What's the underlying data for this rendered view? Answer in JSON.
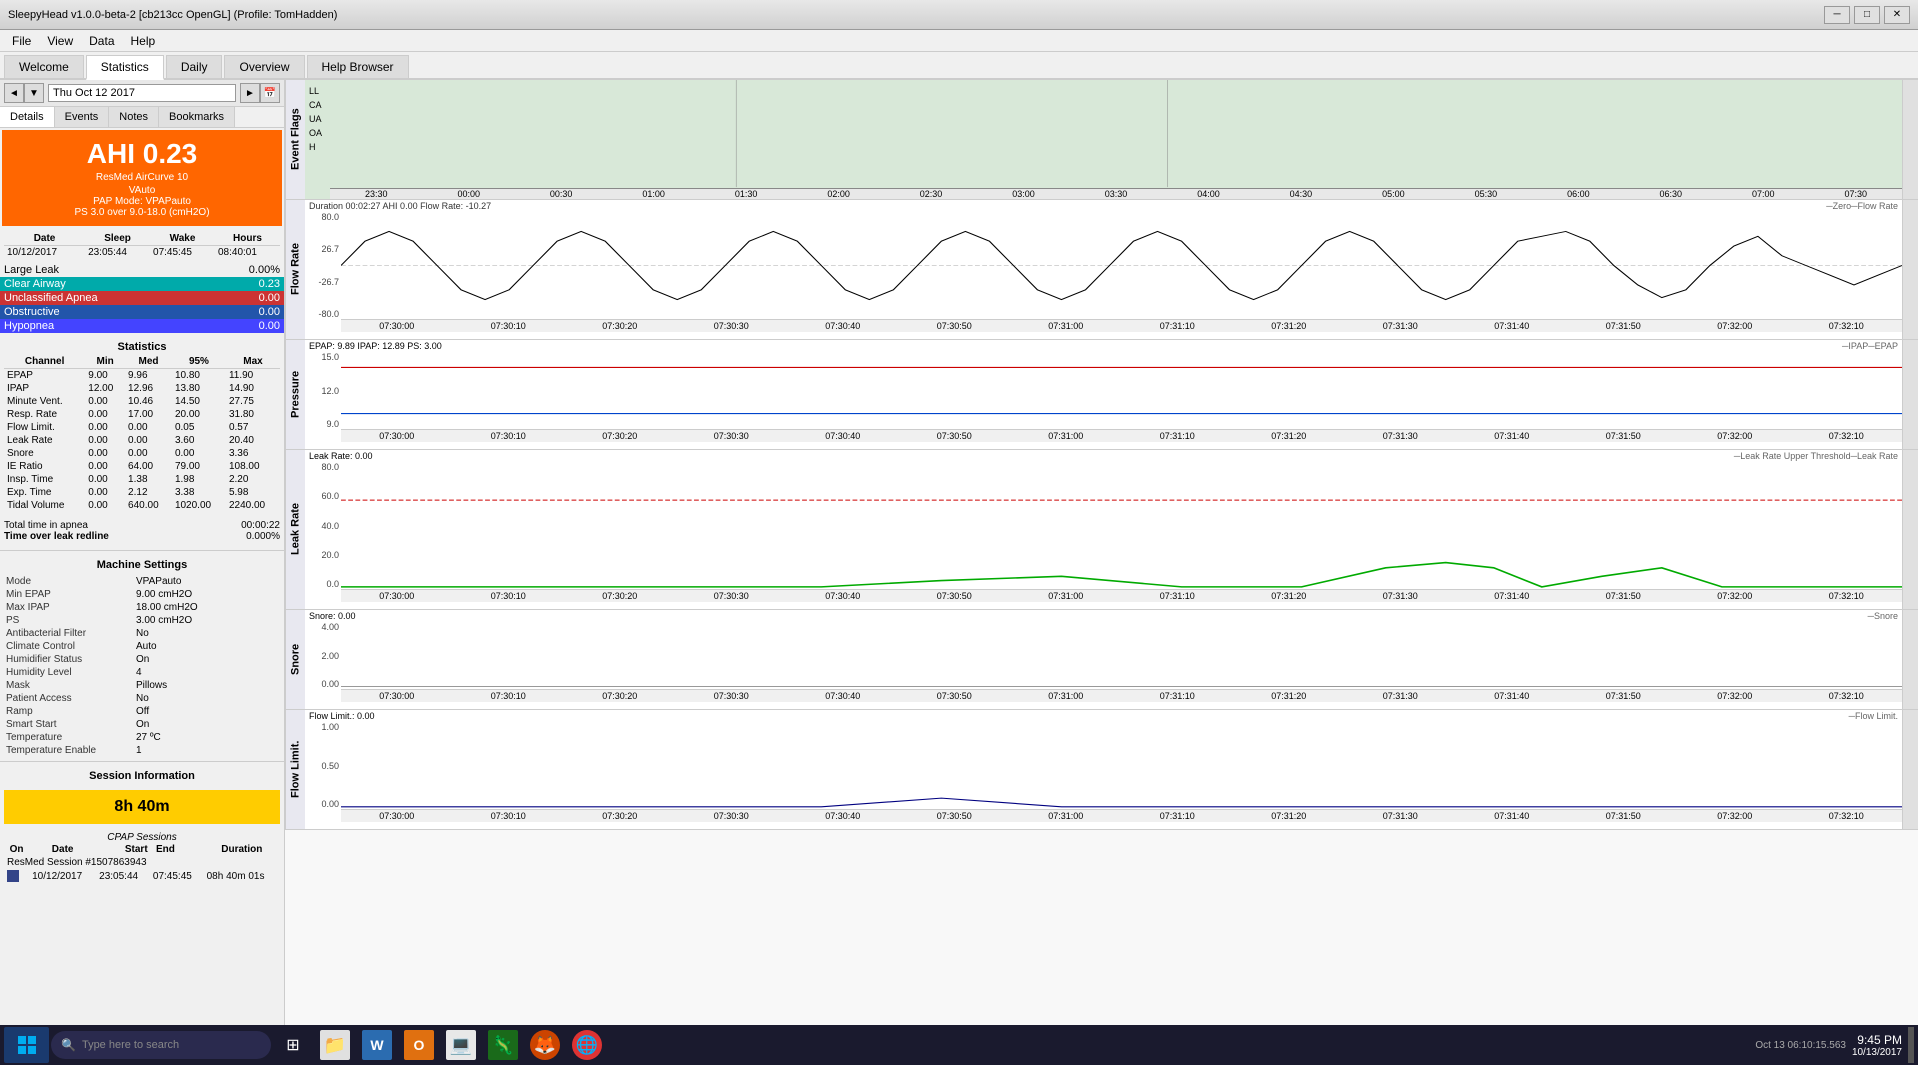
{
  "titlebar": {
    "title": "SleepyHead v1.0.0-beta-2 [cb213cc OpenGL] (Profile: TomHadden)",
    "minimize": "─",
    "maximize": "□",
    "close": "✕"
  },
  "menu": {
    "items": [
      "File",
      "View",
      "Data",
      "Help"
    ]
  },
  "tabs": {
    "items": [
      "Welcome",
      "Statistics",
      "Daily",
      "Overview",
      "Help Browser"
    ],
    "active": "Statistics"
  },
  "date_nav": {
    "prev": "◄",
    "dropdown_arrow": "▼",
    "date": "Thu Oct 12 2017",
    "next": "►",
    "calendar": "📅"
  },
  "subtabs": {
    "items": [
      "Details",
      "Events",
      "Notes",
      "Bookmarks"
    ],
    "active": "Details"
  },
  "ahi": {
    "label": "AHI 0.23",
    "device1": "ResMed AirCurve 10",
    "device2": "VAuto",
    "mode": "PAP Mode: VPAPauto",
    "ps": "PS 3.0 over 9.0-18.0 (cmH2O)"
  },
  "session_summary": {
    "headers": [
      "Date",
      "Sleep",
      "Wake",
      "Hours"
    ],
    "row": [
      "10/12/2017",
      "23:05:44",
      "07:45:45",
      "08:40:01"
    ]
  },
  "events": {
    "large_leak": {
      "label": "Large Leak",
      "value": "0.00%"
    },
    "clear_airway": {
      "label": "Clear Airway",
      "value": "0.23"
    },
    "unclassified_apnea": {
      "label": "Unclassified Apnea",
      "value": "0.00"
    },
    "obstructive": {
      "label": "Obstructive",
      "value": "0.00"
    },
    "hypopnea": {
      "label": "Hypopnea",
      "value": "0.00"
    }
  },
  "statistics": {
    "title": "Statistics",
    "headers": [
      "Channel",
      "Min",
      "Med",
      "95%",
      "Max"
    ],
    "rows": [
      [
        "EPAP",
        "9.00",
        "9.96",
        "10.80",
        "11.90"
      ],
      [
        "IPAP",
        "12.00",
        "12.96",
        "13.80",
        "14.90"
      ],
      [
        "Minute Vent.",
        "0.00",
        "10.46",
        "14.50",
        "27.75"
      ],
      [
        "Resp. Rate",
        "0.00",
        "17.00",
        "20.00",
        "31.80"
      ],
      [
        "Flow Limit.",
        "0.00",
        "0.00",
        "0.05",
        "0.57"
      ],
      [
        "Leak Rate",
        "0.00",
        "0.00",
        "3.60",
        "20.40"
      ],
      [
        "Snore",
        "0.00",
        "0.00",
        "0.00",
        "3.36"
      ],
      [
        "IE Ratio",
        "0.00",
        "64.00",
        "79.00",
        "108.00"
      ],
      [
        "Insp. Time",
        "0.00",
        "1.38",
        "1.98",
        "2.20"
      ],
      [
        "Exp. Time",
        "0.00",
        "2.12",
        "3.38",
        "5.98"
      ],
      [
        "Tidal Volume",
        "0.00",
        "640.00",
        "1020.00",
        "2240.00"
      ]
    ]
  },
  "totals": {
    "apnea_label": "Total time in apnea",
    "apnea_value": "00:00:22",
    "leak_label": "Time over leak redline",
    "leak_value": "0.000%"
  },
  "machine_settings": {
    "title": "Machine Settings",
    "rows": [
      [
        "Mode",
        "VPAPauto"
      ],
      [
        "Min EPAP",
        "9.00 cmH2O"
      ],
      [
        "Max IPAP",
        "18.00 cmH2O"
      ],
      [
        "PS",
        "3.00 cmH2O"
      ],
      [
        "Antibacterial Filter",
        "No"
      ],
      [
        "Climate Control",
        "Auto"
      ],
      [
        "Humidifier Status",
        "On"
      ],
      [
        "Humidity Level",
        "4"
      ],
      [
        "Mask",
        "Pillows"
      ],
      [
        "Patient Access",
        "No"
      ],
      [
        "Ramp",
        "Off"
      ],
      [
        "Smart Start",
        "On"
      ],
      [
        "Temperature",
        "27 ºC"
      ],
      [
        "Temperature Enable",
        "1"
      ]
    ]
  },
  "session_info": {
    "title": "Session Information",
    "duration": "8h 40m"
  },
  "cpap_sessions": {
    "title": "CPAP Sessions",
    "headers": [
      "On",
      "Date",
      "Start",
      "End",
      "Duration"
    ],
    "rows": [
      [
        "●",
        "10/12/2017",
        "23:05:44",
        "07:45:45",
        "08h 40m 01s"
      ]
    ],
    "resmed": "ResMed Session #1507863943"
  },
  "charts": {
    "event_flags": {
      "label": "Event Flags",
      "flags": [
        "LL",
        "CA",
        "UA",
        "OA",
        "H"
      ],
      "times_overview": [
        "23:30",
        "00:00",
        "00:30",
        "01:00",
        "01:30",
        "02:00",
        "02:30",
        "03:00",
        "03:30",
        "04:00",
        "04:30",
        "05:00",
        "05:30",
        "06:00",
        "06:30",
        "07:00",
        "07:30"
      ]
    },
    "flow_rate": {
      "label": "Flow Rate",
      "title": "Duration 00:02:27 AHI 0.00 Flow Rate: -10.27",
      "legend": "─Zero─Flow Rate",
      "y_max": "80.0",
      "y_mid_pos": "26.7",
      "y_mid_neg": "-26.7",
      "y_min": "-80.0",
      "times": [
        "07:30:00",
        "07:30:10",
        "07:30:20",
        "07:30:30",
        "07:30:40",
        "07:30:50",
        "07:31:00",
        "07:31:10",
        "07:31:20",
        "07:31:30",
        "07:31:40",
        "07:31:50",
        "07:32:00",
        "07:32:10"
      ]
    },
    "pressure": {
      "label": "Pressure",
      "title": "EPAP: 9.89 IPAP: 12.89 PS: 3.00",
      "legend": "─IPAP─EPAP",
      "y_max": "15.0",
      "y_mid": "12.0",
      "y_min": "9.0",
      "times": [
        "07:30:00",
        "07:30:10",
        "07:30:20",
        "07:30:30",
        "07:30:40",
        "07:30:50",
        "07:31:00",
        "07:31:10",
        "07:31:20",
        "07:31:30",
        "07:31:40",
        "07:31:50",
        "07:32:00",
        "07:32:10"
      ]
    },
    "leak_rate": {
      "label": "Leak Rate",
      "title": "Leak Rate: 0.00",
      "legend": "─Leak Rate Upper Threshold─Leak Rate",
      "y_max": "80.0",
      "y_60": "60.0",
      "y_40": "40.0",
      "y_20": "20.0",
      "y_0": "0.0",
      "times": [
        "07:30:00",
        "07:30:10",
        "07:30:20",
        "07:30:30",
        "07:30:40",
        "07:30:50",
        "07:31:00",
        "07:31:10",
        "07:31:20",
        "07:31:30",
        "07:31:40",
        "07:31:50",
        "07:32:00",
        "07:32:10"
      ]
    },
    "snore": {
      "label": "Snore",
      "title": "Snore: 0.00",
      "legend": "─Snore",
      "y_max": "4.00",
      "y_mid": "2.00",
      "y_min": "0.00",
      "times": [
        "07:30:00",
        "07:30:10",
        "07:30:20",
        "07:30:30",
        "07:30:40",
        "07:30:50",
        "07:31:00",
        "07:31:10",
        "07:31:20",
        "07:31:30",
        "07:31:40",
        "07:31:50",
        "07:32:00",
        "07:32:10"
      ]
    },
    "flow_limit": {
      "label": "Flow Limit.",
      "title": "Flow Limit.: 0.00",
      "legend": "─Flow Limit.",
      "y_max": "1.00",
      "y_mid": "0.50",
      "y_min": "0.00",
      "times": [
        "07:30:00",
        "07:30:10",
        "07:30:20",
        "07:30:30",
        "07:30:40",
        "07:30:50",
        "07:31:00",
        "07:31:10",
        "07:31:20",
        "07:31:30",
        "07:31:40",
        "07:31:50",
        "07:32:00",
        "07:32:10"
      ]
    }
  },
  "taskbar": {
    "datetime": "Oct 13 06:10:15.563",
    "time": "9:45 PM"
  }
}
